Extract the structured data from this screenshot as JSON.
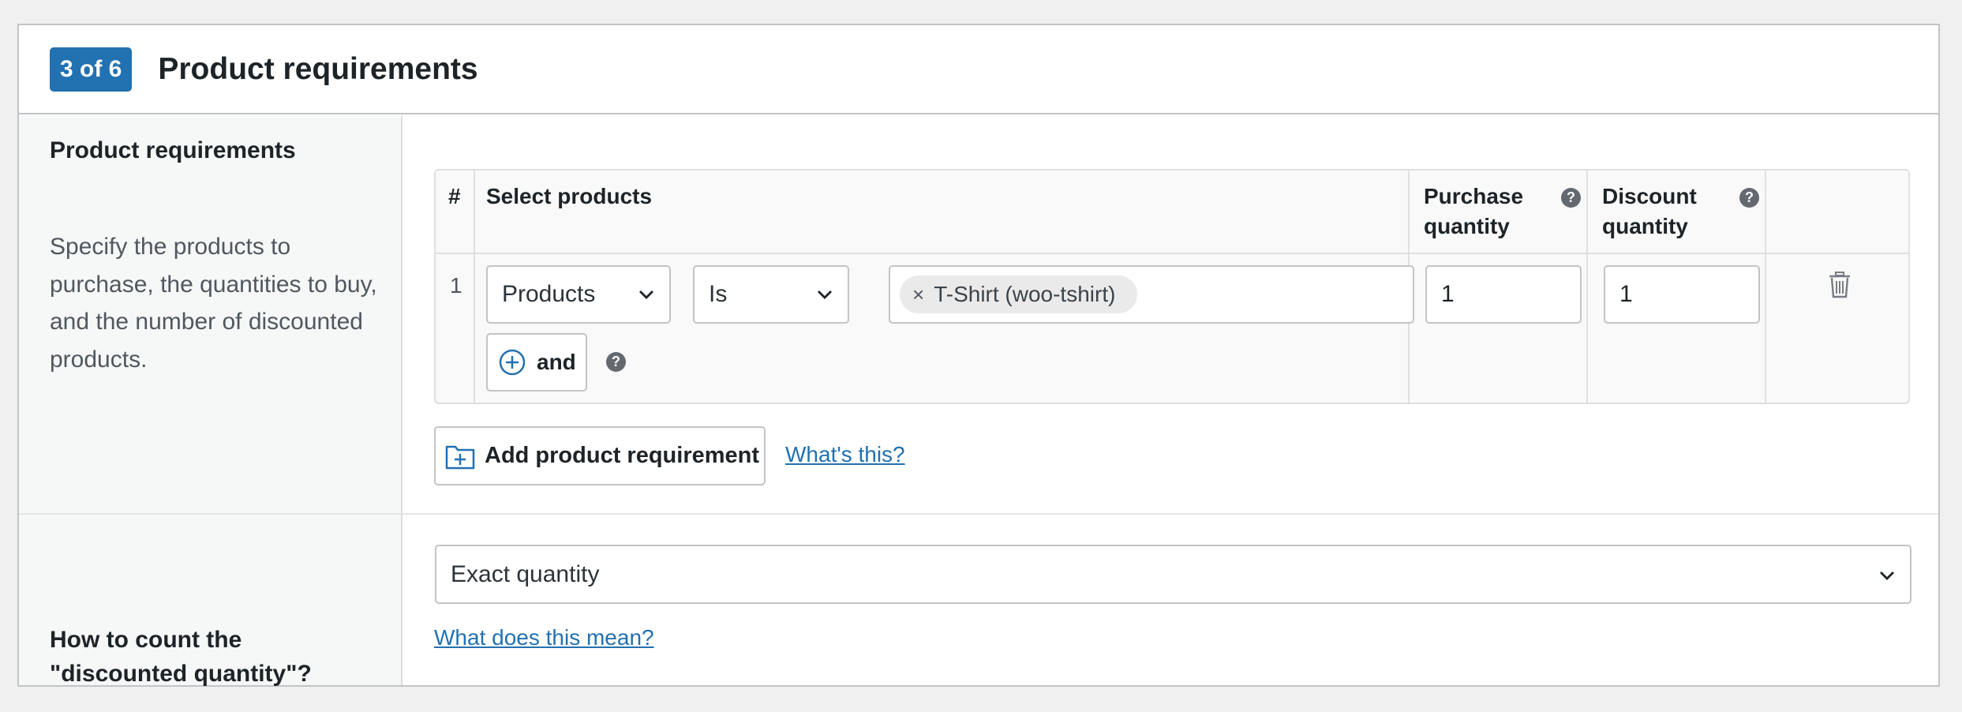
{
  "header": {
    "step_badge": "3 of 6",
    "title": "Product requirements"
  },
  "requirements_section": {
    "title": "Product requirements",
    "description": "Specify the products to purchase, the quantities to buy, and the number of discounted products."
  },
  "table": {
    "headers": {
      "number": "#",
      "select_products": "Select products",
      "purchase_quantity": "Purchase quantity",
      "discount_quantity": "Discount quantity"
    },
    "rows": [
      {
        "number": "1",
        "type_select": "Products",
        "operator_select": "Is",
        "tags": [
          "T-Shirt (woo-tshirt)"
        ],
        "tag_remove": "×",
        "purchase_quantity": "1",
        "discount_quantity": "1",
        "and_button": "and"
      }
    ],
    "help_icon_glyph": "?"
  },
  "actions": {
    "add_requirement": "Add product requirement",
    "whats_this": "What's this?"
  },
  "count_section": {
    "title_line1": "How to count the",
    "title_line2": "\"discounted quantity\"?",
    "selected": "Exact quantity",
    "help_link": "What does this mean?"
  },
  "colors": {
    "accent": "#2271b1",
    "border": "#c3c4c7",
    "background": "#f0f0f1"
  },
  "icons": {
    "delete": "trash-icon",
    "and": "plus-circle-icon",
    "add_requirement": "folder-plus-icon",
    "help": "help-icon",
    "dropdown": "chevron-down-icon"
  }
}
